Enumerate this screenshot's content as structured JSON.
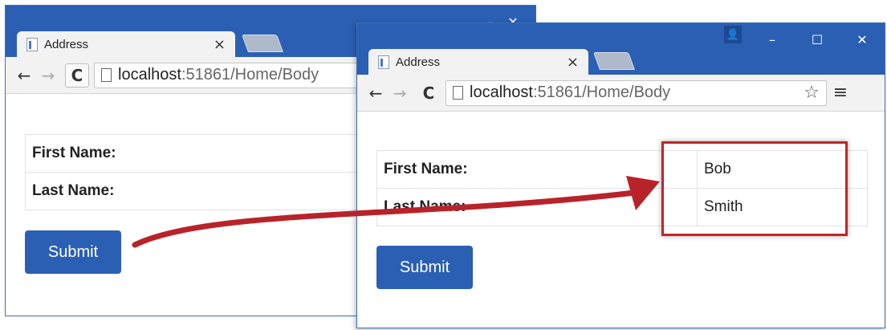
{
  "windows": {
    "back": {
      "tab_title": "Address",
      "tab_close": "×",
      "url_host": "localhost",
      "url_path": ":51861/Home/Body",
      "rows": [
        {
          "label": "First Name:",
          "value": ""
        },
        {
          "label": "Last Name:",
          "value": ""
        }
      ],
      "submit_label": "Submit"
    },
    "front": {
      "tab_title": "Address",
      "tab_close": "×",
      "url_host": "localhost",
      "url_path": ":51861/Home/Body",
      "rows": [
        {
          "label": "First Name:",
          "value": "Bob"
        },
        {
          "label": "Last Name:",
          "value": "Smith"
        }
      ],
      "submit_label": "Submit"
    }
  },
  "window_controls": {
    "minimize": "–",
    "maximize": "☐",
    "close": "✕",
    "user": "👤"
  },
  "toolbar_icons": {
    "back": "←",
    "forward": "→",
    "reload": "C",
    "star": "☆",
    "menu": "≡"
  },
  "colors": {
    "titlebar": "#2b5fb3",
    "button": "#2b5fb3",
    "highlight": "#c0252a",
    "arrow": "#b8232a"
  }
}
